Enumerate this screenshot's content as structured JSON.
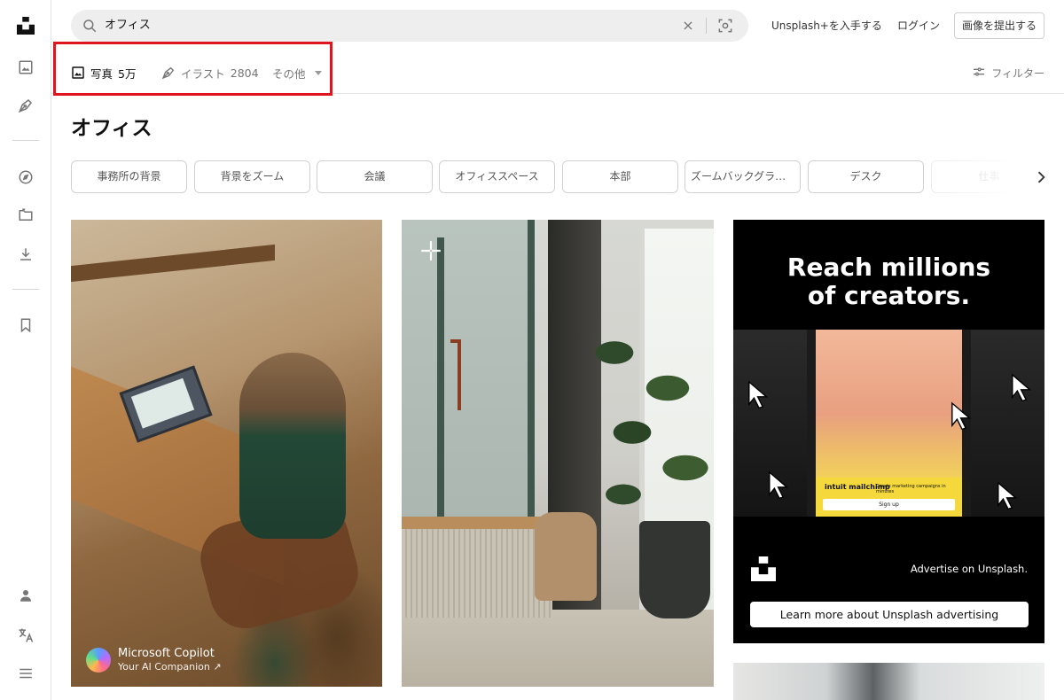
{
  "search": {
    "query": "オフィス",
    "clear_label": "×"
  },
  "topbar": {
    "plus_link": "Unsplash+を入手する",
    "login_link": "ログイン",
    "submit_button": "画像を提出する"
  },
  "tabs": [
    {
      "label": "写真",
      "count": "5万",
      "icon": "image-icon"
    },
    {
      "label": "イラスト",
      "count": "2804",
      "icon": "pen-nib-icon"
    },
    {
      "label": "その他",
      "count": "",
      "icon": "chevron-down-icon"
    }
  ],
  "filter_label": "フィルター",
  "page_title": "オフィス",
  "chips": [
    "事務所の背景",
    "背景をズーム",
    "会議",
    "オフィススペース",
    "本部",
    "ズームバックグラウン…",
    "デスク",
    "仕事"
  ],
  "copilot": {
    "name": "Microsoft Copilot",
    "tagline": "Your AI Companion ↗"
  },
  "ad": {
    "headline_line1": "Reach millions",
    "headline_line2": "of creators.",
    "mailchimp_logo": "intuit mailchimp",
    "mailchimp_tag": "Create marketing campaigns in minutes",
    "mailchimp_button": "Sign up",
    "advertise_text": "Advertise on Unsplash.",
    "learn_more_button": "Learn more about Unsplash advertising"
  },
  "colors": {
    "highlight": "#e0141e",
    "accent": "#111111"
  }
}
